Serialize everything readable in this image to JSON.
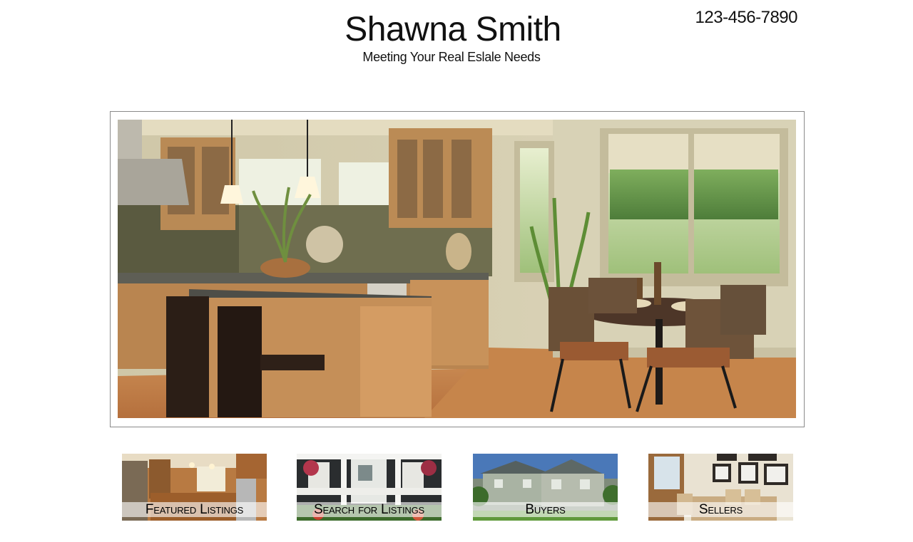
{
  "header": {
    "title": "Shawna Smith",
    "tagline": "Meeting Your Real Eslale Needs",
    "phone": "123-456-7890"
  },
  "hero": {
    "image": "kitchen-dining-room-photo"
  },
  "tiles": [
    {
      "label": "Featured Listings",
      "image": "kitchen-photo"
    },
    {
      "label": "Search for Listings",
      "image": "house-porch-photo"
    },
    {
      "label": "Buyers",
      "image": "house-exterior-photo"
    },
    {
      "label": "Sellers",
      "image": "dining-room-photo"
    }
  ]
}
